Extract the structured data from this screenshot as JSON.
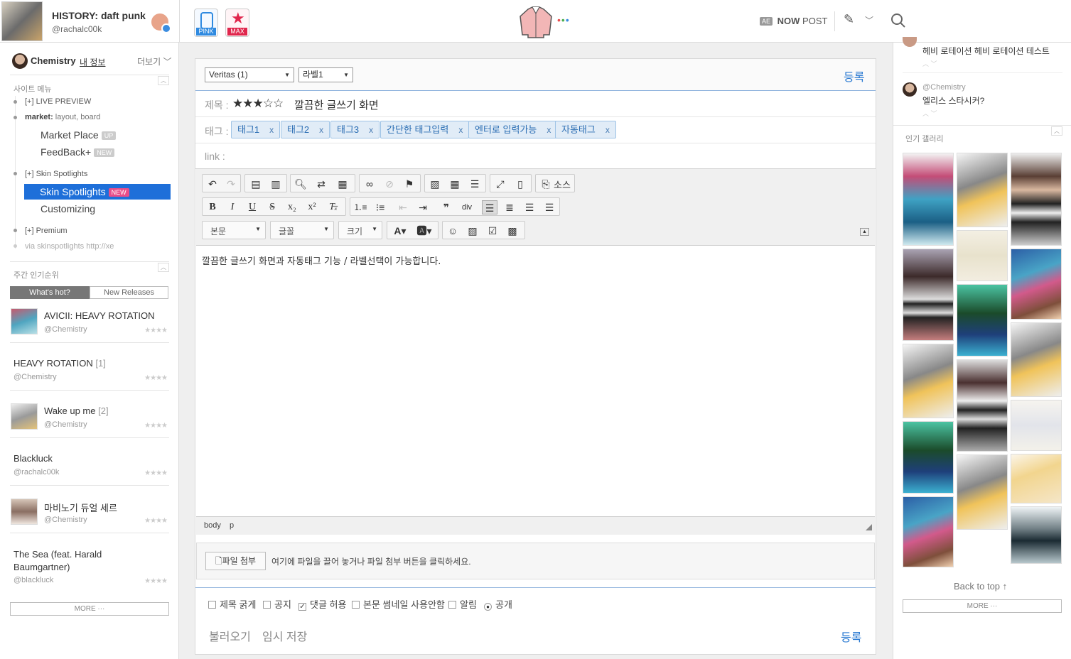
{
  "profile": {
    "title": "HISTORY: daft punk",
    "handle": "@rachalc00k"
  },
  "apps": [
    {
      "label": "PINK",
      "color": "#2f8ae0"
    },
    {
      "label": "MAX",
      "color": "#e0264c"
    }
  ],
  "header_right": {
    "now": "NOW",
    "post": "POST",
    "ae": "AE"
  },
  "user_nav": {
    "name": "Chemistry",
    "my_info": "내 정보",
    "more": "더보기"
  },
  "site_menu": {
    "title": "사이트 메뉴",
    "live_preview": "[+] LIVE PREVIEW",
    "market_bold": "market:",
    "market_rest": " layout, board",
    "market_place": "Market Place",
    "badge_up": "UP",
    "feedback": "FeedBack+",
    "badge_new": "NEW",
    "skin_spotlights_group": "[+] Skin Spotlights",
    "skin_spotlights_active": "Skin Spotlights",
    "customizing": "Customizing",
    "premium": "[+] Premium",
    "via": "via skinspotlights http://xe"
  },
  "weekly": {
    "title": "주간 인기순위",
    "tab_hot": "What's hot?",
    "tab_new": "New Releases",
    "items": [
      {
        "title": "AVICII: HEAVY ROTATION",
        "author": "@Chemistry",
        "count": ""
      },
      {
        "title": "HEAVY ROTATION",
        "author": "@Chemistry",
        "count": "[1]"
      },
      {
        "title": "Wake up me",
        "author": "@Chemistry",
        "count": "[2]"
      },
      {
        "title": "Blackluck",
        "author": "@rachalc00k",
        "count": ""
      },
      {
        "title": "마비노기 듀얼 세르",
        "author": "@Chemistry",
        "count": ""
      },
      {
        "title": "The Sea (feat. Harald Baumgartner)",
        "author": "@blackluck",
        "count": ""
      }
    ],
    "more": "MORE ···",
    "stars": "★★★★"
  },
  "editor": {
    "category": "Veritas (1)",
    "label": "라벨1",
    "submit": "등록",
    "title_label": "제목 :",
    "title_stars": "★★★☆☆",
    "title_value": "깔끔한 글쓰기 화면",
    "tag_label": "태그 :",
    "tags": [
      "태그1",
      "태그2",
      "태그3",
      "간단한 태그입력",
      "엔터로 입력가능",
      "자동태그"
    ],
    "tag_x": "x",
    "link_label": "link :",
    "source": "소스",
    "format_select": "본문",
    "font_select": "글꼴",
    "size_select": "크기",
    "body_text": "깔끔한 글쓰기 화면과 자동태그 기능 / 라벨선택이 가능합니다.",
    "path_body": "body",
    "path_p": "p",
    "file_button": "파일 첨부",
    "file_hint": "여기에 파일을 끌어 놓거나 파일 첨부 버튼을 클릭하세요.",
    "options": [
      {
        "label": "제목 굵게",
        "checked": false
      },
      {
        "label": "공지",
        "checked": false
      },
      {
        "label": "댓글 허용",
        "checked": true
      },
      {
        "label": "본문 썸네일 사용안함",
        "checked": false
      },
      {
        "label": "알림",
        "checked": false
      }
    ],
    "public_label": "공개",
    "load": "불러오기",
    "temp_save": "임시 저장",
    "submit_bottom": "등록"
  },
  "comments": [
    {
      "author": "",
      "text": "헤비 로테이션 헤비 로테이션 테스트"
    },
    {
      "author": "@Chemistry",
      "text": "엘리스 스타시커?"
    }
  ],
  "gallery": {
    "title": "인기 갤러리",
    "back_to_top": "Back to top ↑",
    "more": "MORE ···"
  },
  "colors": {
    "accent": "#1e6fd9",
    "tag_bg": "#e1ecf7",
    "pink": "#e84d8a"
  }
}
